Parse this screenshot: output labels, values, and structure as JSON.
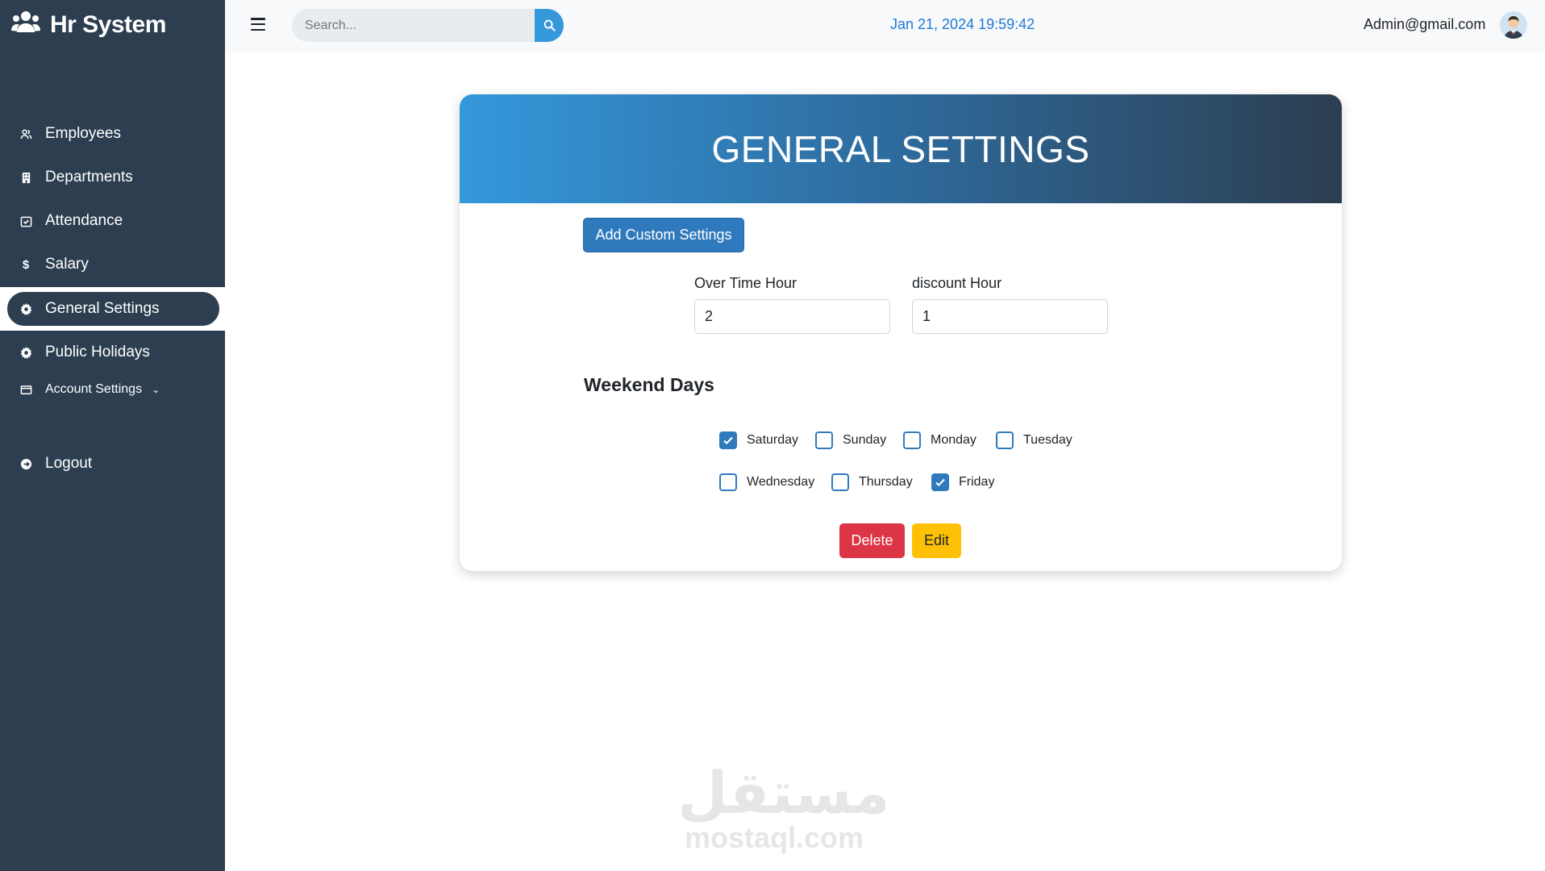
{
  "app": {
    "title": "Hr System"
  },
  "sidebar": {
    "items": [
      {
        "label": "Employees",
        "icon": "users-icon"
      },
      {
        "label": "Departments",
        "icon": "building-icon"
      },
      {
        "label": "Attendance",
        "icon": "calendar-check-icon"
      },
      {
        "label": "Salary",
        "icon": "dollar-icon"
      },
      {
        "label": "General Settings",
        "icon": "gear-icon",
        "active": true
      },
      {
        "label": "Public Holidays",
        "icon": "gear-icon"
      },
      {
        "label": "Account Settings",
        "icon": "id-card-icon",
        "expandable": true
      },
      {
        "label": "Logout",
        "icon": "logout-icon"
      }
    ]
  },
  "topbar": {
    "search_placeholder": "Search...",
    "datetime": "Jan 21, 2024 19:59:42",
    "user_email": "Admin@gmail.com"
  },
  "settings": {
    "title": "GENERAL SETTINGS",
    "add_button": "Add Custom Settings",
    "overtime": {
      "label": "Over Time Hour",
      "value": "2"
    },
    "discount": {
      "label": "discount Hour",
      "value": "1"
    },
    "weekend_title": "Weekend Days",
    "days": [
      {
        "label": "Saturday",
        "checked": true
      },
      {
        "label": "Sunday",
        "checked": false
      },
      {
        "label": "Monday",
        "checked": false
      },
      {
        "label": "Tuesday",
        "checked": false
      },
      {
        "label": "Wednesday",
        "checked": false
      },
      {
        "label": "Thursday",
        "checked": false
      },
      {
        "label": "Friday",
        "checked": true
      }
    ],
    "delete_button": "Delete",
    "edit_button": "Edit"
  },
  "watermark": {
    "arabic": "مستقل",
    "latin": "mostaql.com"
  },
  "colors": {
    "sidebar": "#2c3e50",
    "accent": "#3498db",
    "primary_button": "#2f7abd",
    "danger": "#dc3545",
    "warning": "#ffc107",
    "datetime": "#1e7ad6"
  }
}
